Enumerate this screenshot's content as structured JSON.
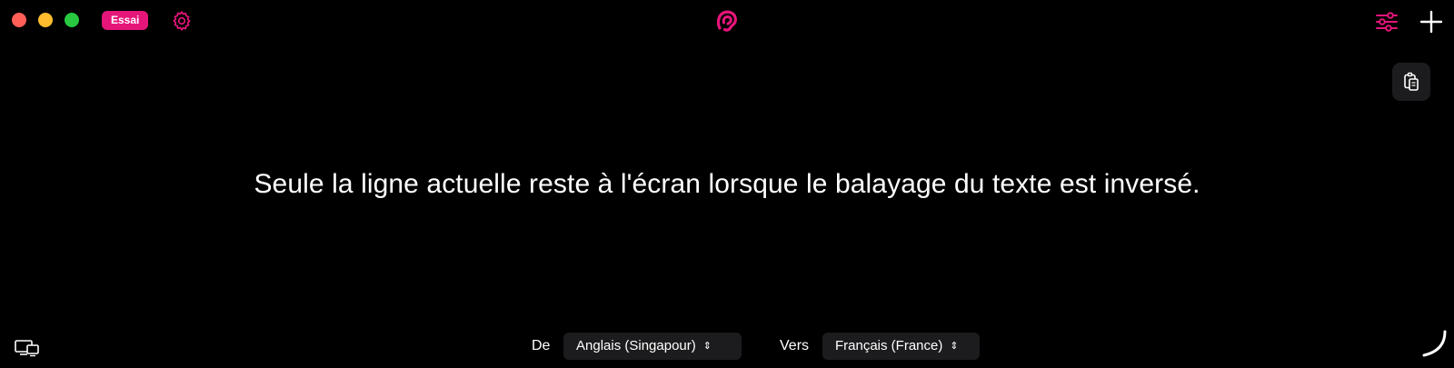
{
  "titlebar": {
    "trial_badge": "Essai"
  },
  "icons": {
    "close": "close-dot",
    "minimize": "minimize-dot",
    "maximize": "maximize-dot",
    "settings": "gear-icon",
    "app_logo": "ear-logo-icon",
    "preferences": "sliders-icon",
    "add": "plus-icon",
    "copy": "copy-icon",
    "display": "screens-icon",
    "activity": "spinner-icon"
  },
  "colors": {
    "accent": "#e6157a",
    "background": "#000000",
    "control_bg": "#1c1c1e"
  },
  "main": {
    "text": "Seule la ligne actuelle reste à l'écran lorsque le balayage du texte est inversé."
  },
  "languages": {
    "from_label": "De",
    "from_value": "Anglais (Singapour)",
    "to_label": "Vers",
    "to_value": "Français (France)"
  }
}
